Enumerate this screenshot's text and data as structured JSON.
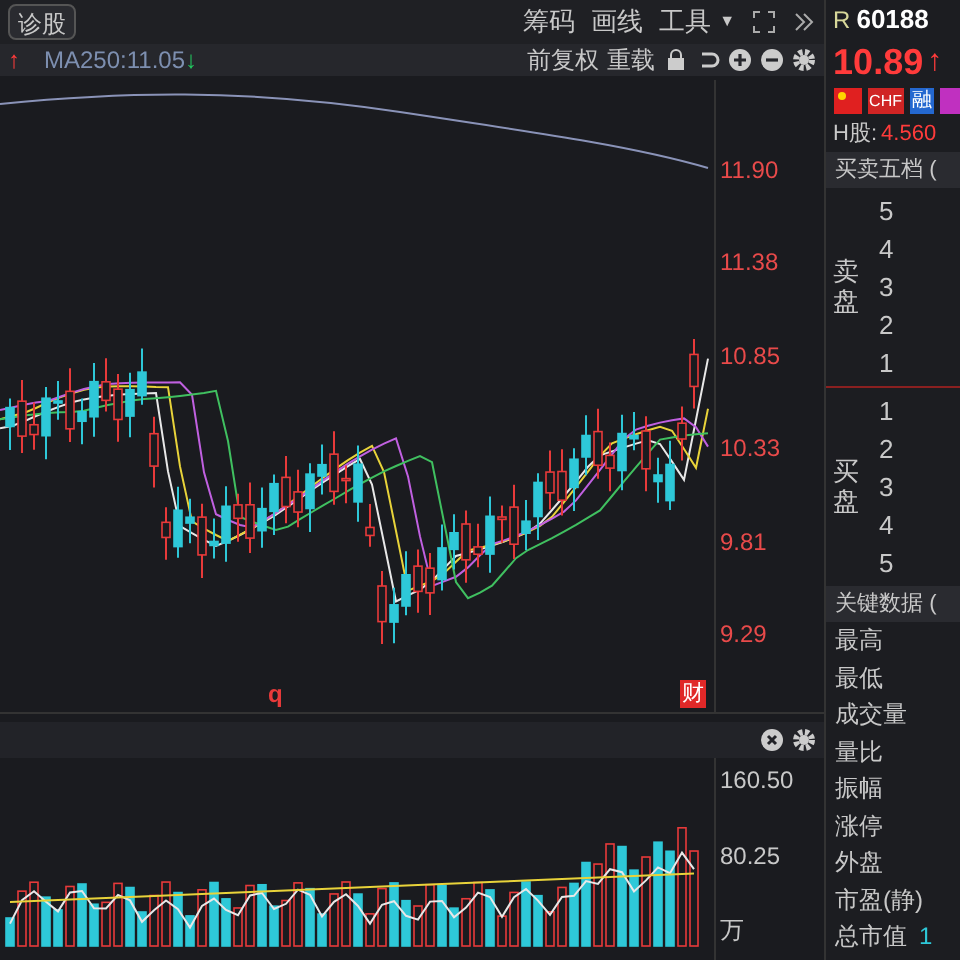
{
  "toolbar": {
    "diagnose_button": "诊股",
    "tools": [
      {
        "label": "筹码",
        "kind": "text"
      },
      {
        "label": "画线",
        "kind": "text"
      },
      {
        "label": "工具",
        "kind": "menu",
        "caret": "▼"
      }
    ]
  },
  "indicator_bar": {
    "lead_arrow": "↑",
    "ma_label": "MA250:11.05",
    "ma_arrow": "↓",
    "actions": [
      "前复权",
      "重载"
    ]
  },
  "price_axis": [
    "11.90",
    "11.38",
    "10.85",
    "10.33",
    "9.81",
    "9.29"
  ],
  "chart_marks": {
    "letter": "q",
    "finance_badge": "财"
  },
  "volume_axis": [
    "160.50",
    "80.25",
    "万"
  ],
  "quote": {
    "market": "R",
    "code": "60188",
    "price": "10.89",
    "price_arrow": "↑",
    "badges": [
      "CHF",
      "融"
    ],
    "h_share_label": "H股:",
    "h_share_price": "4.560"
  },
  "order_book": {
    "title": "买卖五档 (",
    "sell_label": "卖盘",
    "sell_levels": [
      "5",
      "4",
      "3",
      "2",
      "1"
    ],
    "buy_label": "买盘",
    "buy_levels": [
      "1",
      "2",
      "3",
      "4",
      "5"
    ]
  },
  "key_data": {
    "title": "关键数据 (",
    "items": [
      {
        "label": "最高"
      },
      {
        "label": "最低"
      },
      {
        "label": "成交量"
      },
      {
        "label": "量比"
      },
      {
        "label": "振幅"
      },
      {
        "label": "涨停"
      },
      {
        "label": "外盘"
      },
      {
        "label": "市盈(静)"
      },
      {
        "label": "总市值",
        "value": "1"
      }
    ]
  }
}
